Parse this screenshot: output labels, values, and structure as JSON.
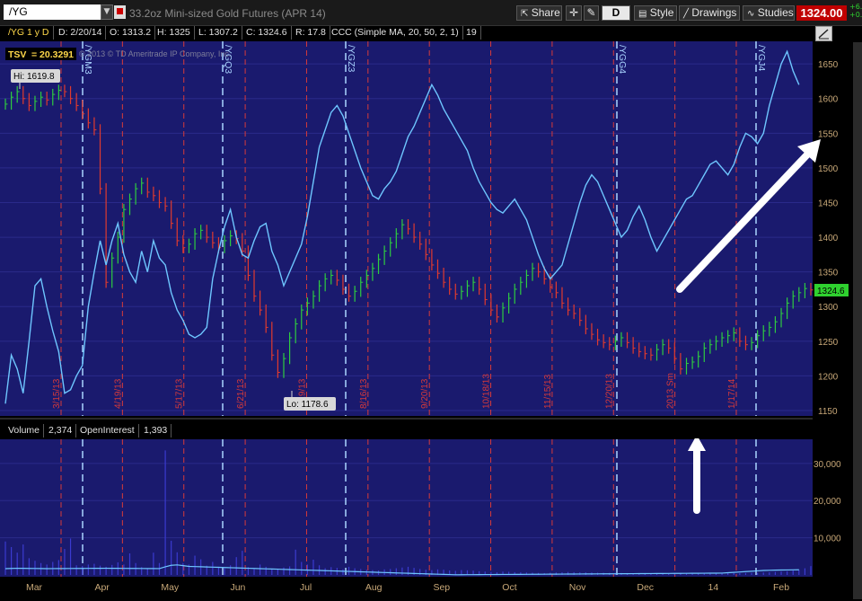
{
  "toolbar": {
    "symbol": "/YG",
    "description": "33.2oz Mini-sized Gold Futures (APR 14)",
    "share_label": "Share",
    "period_label": "D",
    "style_label": "Style",
    "drawings_label": "Drawings",
    "studies_label": "Studies",
    "last_price": "1324.00",
    "change_text": "+6.\n+0.",
    "colors": {
      "last_price_bg": "#c00000",
      "change": "#2fd12f"
    }
  },
  "info": {
    "symbol_tag": "/YG 1 y D",
    "date": "D: 2/20/14",
    "open": "O: 1313.2",
    "high": "H: 1325",
    "low": "L: 1307.2",
    "close": "C: 1324.6",
    "range": "R: 17.8",
    "study": "CCC (Simple MA, 20, 50, 2, 1)",
    "study_value": "19"
  },
  "price_panel": {
    "tsv_label": "TSV",
    "tsv_value": "= 20.3291",
    "copyright": "© 2013 © TD Ameritrade IP Company, Inc.",
    "hi_label": "Hi: 1619.8",
    "lo_label": "Lo: 1178.6",
    "current_label": "1324.6",
    "colors": {
      "background": "#1a1a6e",
      "up_bar": "#2ecc40",
      "down_bar": "#e03a2e",
      "indicator": "#6ec6ff",
      "grid": "#2a2a8a",
      "event_line": "#d63a3a",
      "expiry_line": "#aad4ff",
      "axis_text": "#c8a878"
    }
  },
  "volume_panel": {
    "volume_label": "Volume",
    "volume_value": "2,374",
    "oi_label": "OpenInterest",
    "oi_value": "1,393"
  },
  "chart_data": {
    "type": "line",
    "title": "/YG 1 y D",
    "ylim": [
      1150,
      1680
    ],
    "y_ticks": [
      1650,
      1600,
      1550,
      1500,
      1450,
      1400,
      1350,
      1300,
      1250,
      1200,
      1150
    ],
    "volume_ylim": [
      0,
      36000
    ],
    "volume_ticks": [
      "30,000",
      "20,000",
      "10,000"
    ],
    "volume_tick_values": [
      30000,
      20000,
      10000
    ],
    "x_labels": [
      "Mar",
      "Apr",
      "May",
      "Jun",
      "Jul",
      "Aug",
      "Sep",
      "Oct",
      "Nov",
      "Dec",
      "14",
      "Feb"
    ],
    "event_dates": [
      "3/15/13",
      "4/19/13",
      "5/17/13",
      "6/21/13",
      "7/19/13",
      "8/16/13",
      "9/20/13",
      "10/18/13",
      "11/15/13",
      "12/20/13",
      "2013 Sm",
      "1/17/14"
    ],
    "expiry_labels": [
      "/YGM3",
      "/YGQ3",
      "/YGZ3",
      "/YGG4",
      "/YGJ4"
    ],
    "price_close": [
      1592,
      1602,
      1610,
      1600,
      1590,
      1596,
      1602,
      1598,
      1606,
      1612,
      1610,
      1600,
      1590,
      1578,
      1565,
      1555,
      1470,
      1335,
      1370,
      1400,
      1440,
      1455,
      1470,
      1478,
      1465,
      1460,
      1450,
      1445,
      1420,
      1395,
      1385,
      1390,
      1405,
      1410,
      1400,
      1392,
      1385,
      1395,
      1402,
      1398,
      1380,
      1345,
      1315,
      1295,
      1270,
      1230,
      1205,
      1225,
      1255,
      1275,
      1295,
      1305,
      1315,
      1330,
      1340,
      1345,
      1338,
      1325,
      1315,
      1322,
      1335,
      1345,
      1355,
      1368,
      1380,
      1392,
      1405,
      1418,
      1412,
      1400,
      1390,
      1375,
      1360,
      1348,
      1335,
      1325,
      1318,
      1322,
      1330,
      1335,
      1325,
      1310,
      1295,
      1285,
      1298,
      1312,
      1325,
      1335,
      1345,
      1355,
      1350,
      1340,
      1328,
      1320,
      1305,
      1295,
      1290,
      1280,
      1268,
      1260,
      1252,
      1248,
      1245,
      1250,
      1255,
      1248,
      1240,
      1235,
      1232,
      1230,
      1238,
      1245,
      1240,
      1225,
      1210,
      1218,
      1220,
      1228,
      1240,
      1245,
      1250,
      1255,
      1258,
      1262,
      1250,
      1245,
      1248,
      1258,
      1265,
      1270,
      1278,
      1290,
      1305,
      1315,
      1320,
      1326,
      1324
    ],
    "indicator": [
      1160,
      1230,
      1210,
      1175,
      1250,
      1330,
      1340,
      1300,
      1265,
      1235,
      1175,
      1180,
      1200,
      1215,
      1300,
      1350,
      1395,
      1360,
      1395,
      1420,
      1375,
      1350,
      1335,
      1380,
      1350,
      1395,
      1370,
      1360,
      1320,
      1295,
      1280,
      1260,
      1255,
      1260,
      1270,
      1340,
      1380,
      1415,
      1440,
      1400,
      1375,
      1370,
      1395,
      1415,
      1420,
      1380,
      1360,
      1330,
      1350,
      1370,
      1390,
      1430,
      1480,
      1530,
      1555,
      1580,
      1590,
      1575,
      1550,
      1525,
      1500,
      1480,
      1460,
      1455,
      1470,
      1480,
      1495,
      1520,
      1545,
      1560,
      1580,
      1600,
      1620,
      1605,
      1585,
      1570,
      1555,
      1540,
      1525,
      1500,
      1480,
      1465,
      1450,
      1440,
      1435,
      1445,
      1455,
      1440,
      1425,
      1400,
      1375,
      1355,
      1340,
      1350,
      1360,
      1390,
      1420,
      1450,
      1475,
      1490,
      1480,
      1460,
      1440,
      1420,
      1400,
      1410,
      1430,
      1445,
      1425,
      1400,
      1380,
      1395,
      1410,
      1425,
      1440,
      1455,
      1460,
      1475,
      1490,
      1505,
      1510,
      1500,
      1490,
      1505,
      1530,
      1550,
      1545,
      1535,
      1550,
      1590,
      1620,
      1650,
      1668,
      1640,
      1620
    ],
    "volume_bars": [
      9000,
      7500,
      6000,
      8200,
      4500,
      3800,
      3200,
      2800,
      3500,
      4000,
      7000,
      9800,
      2600,
      2400,
      2800,
      3000,
      2500,
      2200,
      2700,
      3400,
      2800,
      5800,
      3200,
      2100,
      1800,
      6000,
      3200,
      33500,
      9200,
      6100,
      3200,
      2800,
      5200,
      4200,
      2500,
      3500,
      2200,
      1800,
      2600,
      4800,
      6500,
      2100,
      1600,
      2800,
      2200,
      1500,
      1700,
      2000,
      2300,
      6800,
      3500,
      2800,
      4100,
      2600,
      1800,
      2100,
      1900,
      1500,
      2200,
      1800,
      1600,
      1400,
      1300,
      1200,
      1500,
      1600,
      1800,
      2000,
      2200,
      1900,
      1600,
      1400,
      1300,
      1500,
      1400,
      1200,
      1100,
      1300,
      1250,
      1150,
      1000,
      900,
      800,
      700,
      900,
      850,
      750,
      700,
      650,
      600,
      550,
      500,
      600,
      650,
      700,
      800,
      750,
      700,
      680,
      650,
      600,
      580,
      560,
      540,
      520,
      500,
      480,
      470,
      460,
      450,
      440,
      430,
      420,
      410,
      400,
      410,
      420,
      430,
      440,
      450,
      460,
      470,
      480,
      500,
      520,
      540,
      560,
      600,
      650,
      700,
      800,
      900,
      1000,
      1200,
      1400,
      1800,
      2374
    ],
    "open_interest": [
      1700,
      1750,
      1800,
      1780,
      1760,
      1740,
      1720,
      1700,
      1710,
      1720,
      1730,
      1740,
      1750,
      1760,
      1770,
      1780,
      1790,
      1800,
      1790,
      1780,
      1770,
      1760,
      1750,
      1740,
      1730,
      1720,
      1710,
      2200,
      2600,
      2700,
      2500,
      2300,
      2250,
      2200,
      2150,
      2100,
      2050,
      2000,
      1950,
      1900,
      1850,
      1800,
      1750,
      1700,
      1650,
      1600,
      1550,
      1500,
      1450,
      1400,
      1350,
      1300,
      1250,
      1200,
      1150,
      1100,
      1050,
      1000,
      950,
      900,
      850,
      800,
      750,
      700,
      650,
      600,
      550,
      500,
      450,
      400,
      350,
      300,
      250,
      200,
      150,
      100,
      50,
      60,
      70,
      80,
      90,
      100,
      110,
      120,
      130,
      140,
      150,
      160,
      170,
      180,
      190,
      200,
      210,
      220,
      230,
      240,
      250,
      260,
      270,
      280,
      290,
      300,
      310,
      320,
      330,
      340,
      350,
      360,
      370,
      380,
      390,
      400,
      410,
      420,
      430,
      440,
      450,
      460,
      470,
      480,
      490,
      500,
      600,
      700,
      800,
      900,
      1000,
      1100,
      1200,
      1250,
      1300,
      1330,
      1350,
      1370,
      1393
    ]
  }
}
